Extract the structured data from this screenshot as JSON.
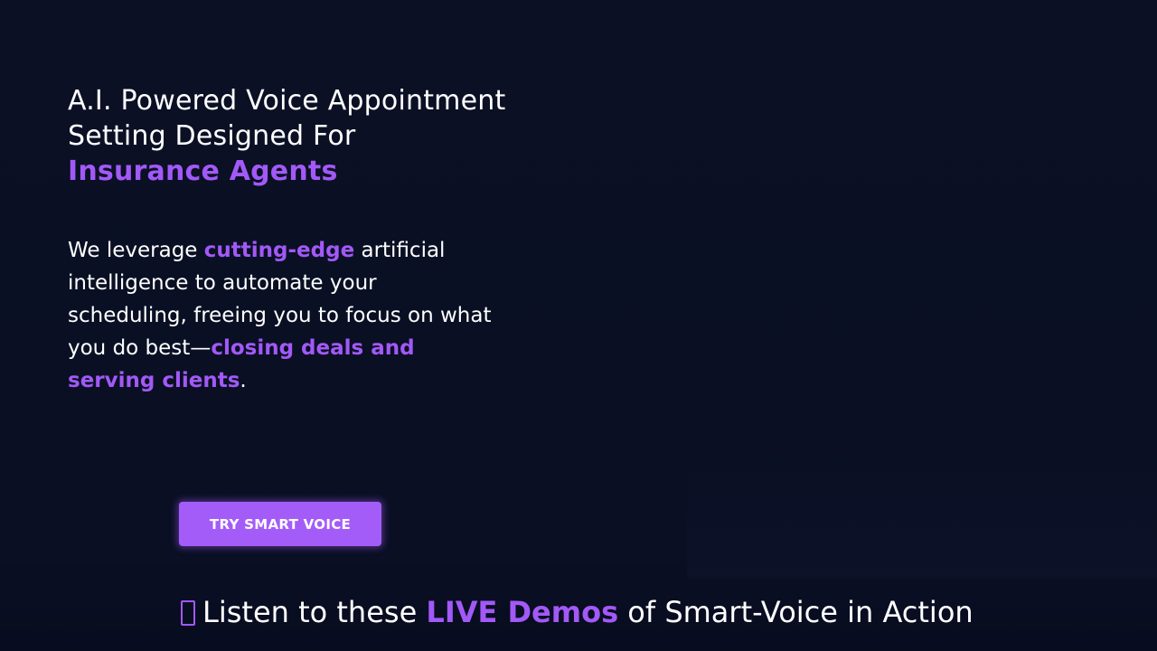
{
  "hero": {
    "title_line": "A.I. Powered Voice Appointment Setting Designed For",
    "title_accent": "Insurance Agents",
    "desc_part1": "We leverage ",
    "desc_hl1": "cutting-edge",
    "desc_part2": " artificial intelligence to automate your scheduling, freeing you to focus on what you do best—",
    "desc_hl2": "closing deals and serving clients",
    "desc_part3": "."
  },
  "cta": {
    "label": "TRY SMART VOICE"
  },
  "demos": {
    "icon": "microphone-icon",
    "prefix": "Listen to these ",
    "highlight": "LIVE Demos",
    "suffix": " of Smart-Voice in Action"
  },
  "colors": {
    "background": "#0b1024",
    "accent": "#a259f7",
    "button": "#a45cf8",
    "text": "#ffffff"
  }
}
